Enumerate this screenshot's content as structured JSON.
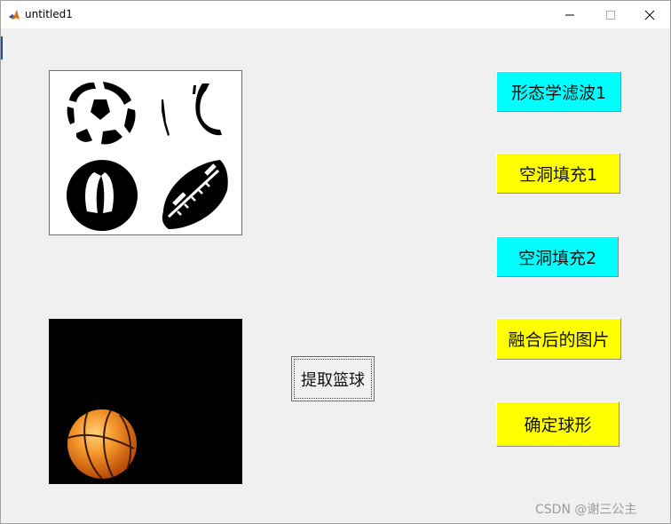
{
  "window": {
    "title": "untitled1",
    "minimize_glyph": "─",
    "maximize_glyph": "☐",
    "close_glyph": "✕"
  },
  "buttons": {
    "morph_filter": "形态学滤波1",
    "hole_fill_1": "空洞填充1",
    "hole_fill_2": "空洞填充2",
    "fused_image": "融合后的图片",
    "determine_ball": "确定球形",
    "extract_basketball": "提取篮球"
  },
  "colors": {
    "cyan": "#00ffff",
    "yellow": "#ffff00"
  },
  "watermark": "CSDN @谢三公主",
  "icons": [
    "matlab-logo-icon",
    "minimize-icon",
    "maximize-icon",
    "close-icon"
  ]
}
